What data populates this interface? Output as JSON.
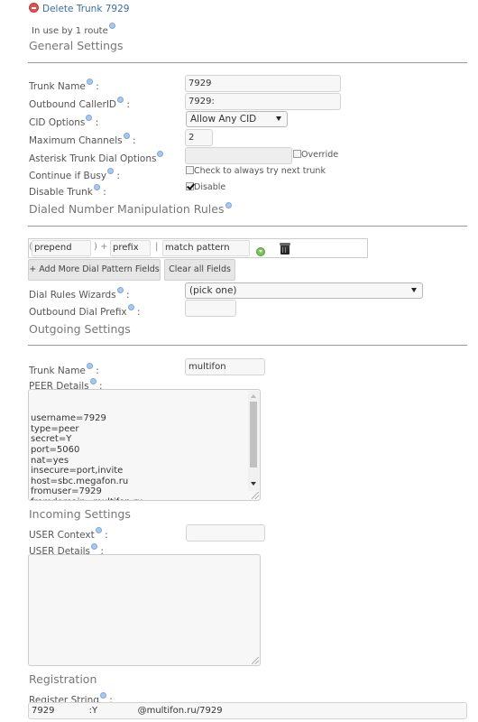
{
  "header": {
    "delete_link": "Delete Trunk 7929",
    "in_use": "In use by 1 route"
  },
  "general": {
    "title": "General Settings",
    "trunk_name_label": "Trunk Name",
    "trunk_name_value": "7929",
    "outbound_cid_label": "Outbound CallerID",
    "outbound_cid_value": "7929:",
    "cid_options_label": "CID Options",
    "cid_options_value": "Allow Any CID",
    "max_channels_label": "Maximum Channels",
    "max_channels_value": "2",
    "dial_options_label": "Asterisk Trunk Dial Options",
    "dial_options_value": "",
    "override_label": "Override",
    "override_checked": false,
    "continue_busy_label": "Continue if Busy",
    "continue_busy_text": "Check to always try next trunk",
    "continue_busy_checked": false,
    "disable_label": "Disable Trunk",
    "disable_text": "Disable",
    "disable_checked": true,
    "colon": ":"
  },
  "dialrules": {
    "title": "Dialed Number Manipulation Rules",
    "prepend_placeholder": "prepend",
    "prefix_placeholder": "prefix",
    "match_placeholder": "match pattern",
    "open_paren": "(",
    "close_paren_plus": ") +",
    "pipe": "|",
    "add_more_button": "+ Add More Dial Pattern Fields",
    "clear_button": "Clear all Fields",
    "wizards_label": "Dial Rules Wizards",
    "wizards_value": "(pick one)",
    "outbound_prefix_label": "Outbound Dial Prefix",
    "outbound_prefix_value": ""
  },
  "outgoing": {
    "title": "Outgoing Settings",
    "trunk_name_label": "Trunk Name",
    "trunk_name_value": "multifon",
    "peer_label": "PEER Details",
    "peer_details": "username=7929\ntype=peer\nsecret=Y\nport=5060\nnat=yes\ninsecure=port,invite\nhost=sbc.megafon.ru\nfromuser=7929\nfromdomain=multifon.ru\ndtmfmode=inband"
  },
  "incoming": {
    "title": "Incoming Settings",
    "user_context_label": "USER Context",
    "user_context_value": "",
    "user_details_label": "USER Details",
    "user_details_value": ""
  },
  "registration": {
    "title": "Registration",
    "register_label": "Register String",
    "register_value": "7929            :Y              @multifon.ru/7929"
  }
}
